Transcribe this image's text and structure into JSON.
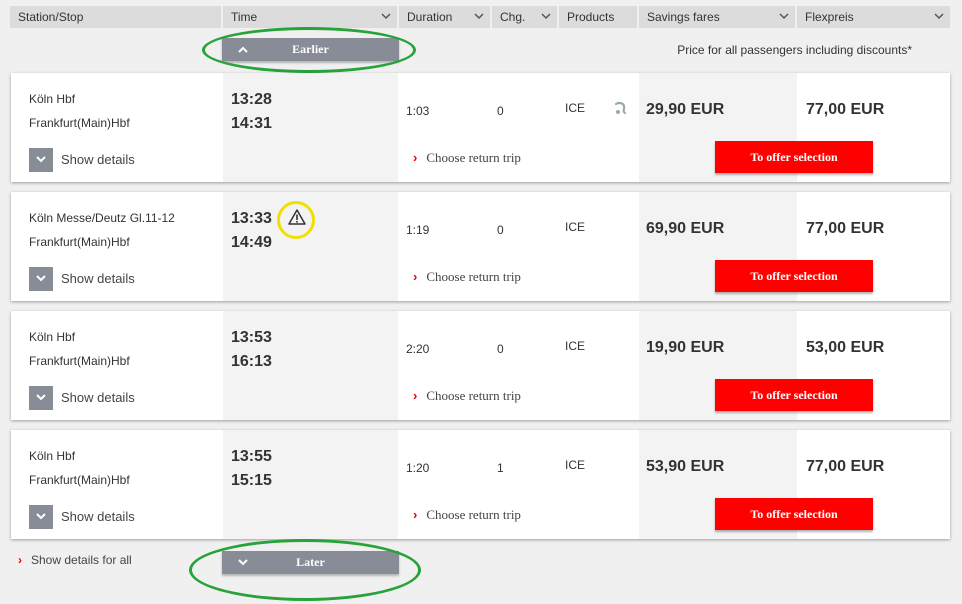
{
  "header": {
    "columns": [
      {
        "key": "station",
        "label": "Station/Stop",
        "sortable": false
      },
      {
        "key": "time",
        "label": "Time",
        "sortable": true
      },
      {
        "key": "duration",
        "label": "Duration",
        "sortable": true
      },
      {
        "key": "changes",
        "label": "Chg.",
        "sortable": true
      },
      {
        "key": "products",
        "label": "Products",
        "sortable": false
      },
      {
        "key": "savings",
        "label": "Savings fares",
        "sortable": true
      },
      {
        "key": "flex",
        "label": "Flexpreis",
        "sortable": true
      }
    ]
  },
  "earlier_label": "Earlier",
  "later_label": "Later",
  "price_note": "Price for all passengers including discounts*",
  "show_details_label": "Show details",
  "choose_return_label": "Choose return trip",
  "offer_label": "To offer selection",
  "show_all_label": "Show details for all",
  "connections": [
    {
      "from": "Köln Hbf",
      "to": "Frankfurt(Main)Hbf",
      "dep": "13:28",
      "arr": "14:31",
      "duration": "1:03",
      "changes": "0",
      "product": "ICE",
      "savings": "29,90 EUR",
      "flex": "77,00 EUR",
      "warning": false,
      "product_icon": "seat-reservation-icon"
    },
    {
      "from": "Köln Messe/Deutz Gl.11-12",
      "to": "Frankfurt(Main)Hbf",
      "dep": "13:33",
      "arr": "14:49",
      "duration": "1:19",
      "changes": "0",
      "product": "ICE",
      "savings": "69,90 EUR",
      "flex": "77,00 EUR",
      "warning": true
    },
    {
      "from": "Köln Hbf",
      "to": "Frankfurt(Main)Hbf",
      "dep": "13:53",
      "arr": "16:13",
      "duration": "2:20",
      "changes": "0",
      "product": "ICE",
      "savings": "19,90 EUR",
      "flex": "53,00 EUR",
      "warning": false
    },
    {
      "from": "Köln Hbf",
      "to": "Frankfurt(Main)Hbf",
      "dep": "13:55",
      "arr": "15:15",
      "duration": "1:20",
      "changes": "1",
      "product": "ICE",
      "savings": "53,90 EUR",
      "flex": "77,00 EUR",
      "warning": false
    }
  ],
  "colors": {
    "accent_red": "#ff0000",
    "button_gray": "#878c96",
    "highlight_green": "#27a33a",
    "highlight_yellow": "#f0e000"
  }
}
